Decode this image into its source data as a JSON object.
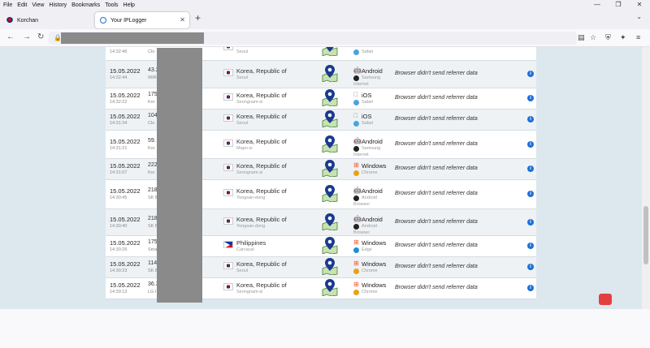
{
  "menu": [
    "File",
    "Edit",
    "View",
    "History",
    "Bookmarks",
    "Tools",
    "Help"
  ],
  "tabs": [
    {
      "label": "Korchan",
      "active": false
    },
    {
      "label": "Your IPLogger",
      "active": true
    }
  ],
  "rows": [
    {
      "date": "",
      "time": "14:32:46",
      "ip": "",
      "ipsub": "Clo",
      "flag": "kr",
      "country": "",
      "city": "Seoul",
      "os": "",
      "osicon": "",
      "browser": "Safari",
      "browser2": "",
      "ref": "",
      "partial": true
    },
    {
      "date": "15.05.2022",
      "time": "14:32:44",
      "ip": "43.2",
      "ipsub": "WIR",
      "flag": "kr",
      "country": "Korea, Republic of",
      "city": "Seoul",
      "os": "Android",
      "osicon": "android",
      "browser": "Samsung",
      "browser2": "Internet",
      "ref": "Browser didn't send referrer data"
    },
    {
      "date": "15.05.2022",
      "time": "14:32:22",
      "ip": "175",
      "ipsub": "Kor",
      "flag": "kr",
      "country": "Korea, Republic of",
      "city": "Seongnam-si",
      "os": "iOS",
      "osicon": "ios",
      "browser": "Safari",
      "browser2": "",
      "ref": "Browser didn't send referrer data"
    },
    {
      "date": "15.05.2022",
      "time": "14:31:34",
      "ip": "104",
      "ipsub": "Clo",
      "flag": "kr",
      "country": "Korea, Republic of",
      "city": "Seoul",
      "os": "iOS",
      "osicon": "ios",
      "browser": "Safari",
      "browser2": "",
      "ref": "Browser didn't send referrer data"
    },
    {
      "date": "15.05.2022",
      "time": "14:31:21",
      "ip": "59.",
      "ipsub": "Kor",
      "flag": "kr",
      "country": "Korea, Republic of",
      "city": "Mapo-si",
      "os": "Android",
      "osicon": "android",
      "browser": "Samsung",
      "browser2": "Internet",
      "ref": "Browser didn't send referrer data"
    },
    {
      "date": "15.05.2022",
      "time": "14:31:07",
      "ip": "222",
      "ipsub": "Kor",
      "flag": "kr",
      "country": "Korea, Republic of",
      "city": "Seongnam-si",
      "os": "Windows",
      "osicon": "windows",
      "browser": "Chrome",
      "browser2": "",
      "ref": "Browser didn't send referrer data"
    },
    {
      "date": "15.05.2022",
      "time": "14:30:45",
      "ip": "218",
      "ipsub": "SK B",
      "flag": "kr",
      "country": "Korea, Republic of",
      "city": "Yongsan-dong",
      "os": "Android",
      "osicon": "android",
      "browser": "Android",
      "browser2": "Browser",
      "ref": "Browser didn't send referrer data"
    },
    {
      "date": "15.05.2022",
      "time": "14:30:40",
      "ip": "218",
      "ipsub": "SK B",
      "flag": "kr",
      "country": "Korea, Republic of",
      "city": "Yongsan-dong",
      "os": "Android",
      "osicon": "android",
      "browser": "Android",
      "browser2": "Browser",
      "ref": "Browser didn't send referrer data"
    },
    {
      "date": "15.05.2022",
      "time": "14:30:26",
      "ip": "175",
      "ipsub": "Sma",
      "flag": "ph",
      "country": "Philippines",
      "city": "Carcacal",
      "os": "Windows",
      "osicon": "windows",
      "browser": "Edge",
      "browser2": "",
      "ref": "Browser didn't send referrer data"
    },
    {
      "date": "15.05.2022",
      "time": "14:30:23",
      "ip": "114",
      "ipsub": "SK B",
      "flag": "kr",
      "country": "Korea, Republic of",
      "city": "Seoul",
      "os": "Windows",
      "osicon": "windows",
      "browser": "Chrome",
      "browser2": "",
      "ref": "Browser didn't send referrer data"
    },
    {
      "date": "15.05.2022",
      "time": "14:30:13",
      "ip": "36.3",
      "ipsub": "LG I",
      "flag": "kr",
      "country": "Korea, Republic of",
      "city": "Seongnam-si",
      "os": "Windows",
      "osicon": "windows",
      "browser": "Chrome",
      "browser2": "",
      "ref": "Browser didn't send referrer data"
    }
  ],
  "colors": {
    "accent": "#1d6fd8",
    "map_pin": "#1a3a8f",
    "content_bg": "#dde7ee",
    "redaction": "#8a8a8a"
  }
}
